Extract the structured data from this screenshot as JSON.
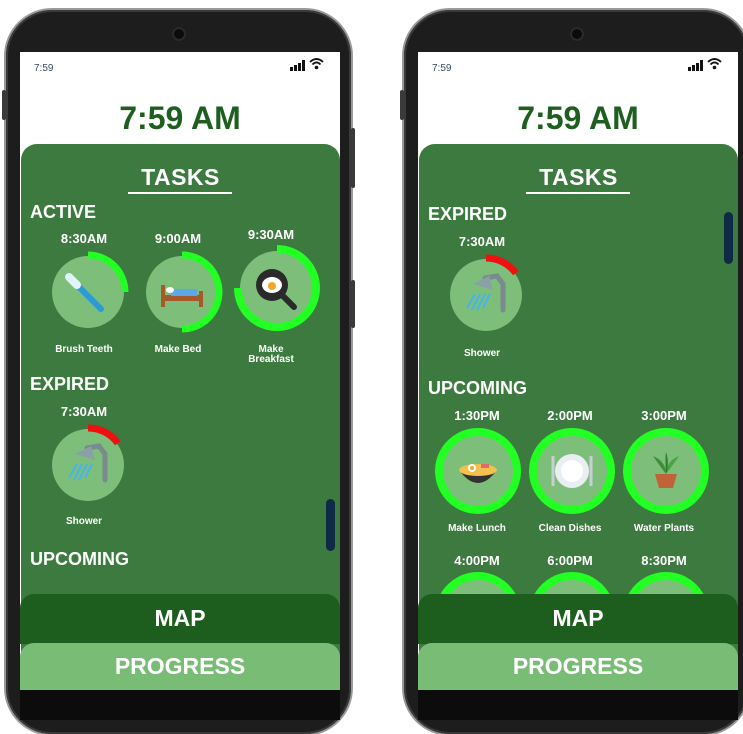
{
  "left_phone": {
    "status_time": "7:59",
    "clock": "7:59 AM",
    "tasks_title": "TASKS",
    "active_heading": "ACTIVE",
    "active_tasks": [
      {
        "time": "8:30AM",
        "label": "Brush Teeth",
        "icon": "toothbrush-icon",
        "ring_progress": 0.25,
        "ring_color": "#22ff22"
      },
      {
        "time": "9:00AM",
        "label": "Make Bed",
        "icon": "bed-icon",
        "ring_progress": 0.5,
        "ring_color": "#22ff22"
      },
      {
        "time": "9:30AM",
        "label": "Make Breakfast",
        "icon": "frying-pan-icon",
        "ring_progress": 0.75,
        "ring_color": "#22ff22"
      }
    ],
    "expired_heading": "EXPIRED",
    "expired_tasks": [
      {
        "time": "7:30AM",
        "label": "Shower",
        "icon": "shower-icon",
        "ring_progress": 0.15,
        "ring_color": "#ee1111"
      }
    ],
    "upcoming_heading": "UPCOMING",
    "map_label": "MAP",
    "progress_label": "PROGRESS"
  },
  "right_phone": {
    "status_time": "7:59",
    "clock": "7:59 AM",
    "tasks_title": "TASKS",
    "expired_heading": "EXPIRED",
    "expired_tasks": [
      {
        "time": "7:30AM",
        "label": "Shower",
        "icon": "shower-icon",
        "ring_progress": 0.15,
        "ring_color": "#ee1111"
      }
    ],
    "upcoming_heading": "UPCOMING",
    "upcoming_tasks": [
      {
        "time": "1:30PM",
        "label": "Make Lunch",
        "icon": "noodle-bowl-icon",
        "ring_progress": 1.0,
        "ring_color": "#22ff22"
      },
      {
        "time": "2:00PM",
        "label": "Clean Dishes",
        "icon": "plate-icon",
        "ring_progress": 1.0,
        "ring_color": "#22ff22"
      },
      {
        "time": "3:00PM",
        "label": "Water Plants",
        "icon": "potted-plant-icon",
        "ring_progress": 1.0,
        "ring_color": "#22ff22"
      }
    ],
    "upcoming_tasks_row2": [
      {
        "time": "4:00PM",
        "ring_progress": 1.0,
        "ring_color": "#22ff22"
      },
      {
        "time": "6:00PM",
        "ring_progress": 1.0,
        "ring_color": "#22ff22"
      },
      {
        "time": "8:30PM",
        "ring_progress": 1.0,
        "ring_color": "#22ff22"
      }
    ],
    "map_label": "MAP",
    "progress_label": "PROGRESS"
  },
  "colors": {
    "panel_green": "#3d7a3f",
    "map_green": "#1d5e1f",
    "progress_green": "#79bc76",
    "clock_green": "#1e5f20",
    "ring_active": "#22ff22",
    "ring_expired": "#ee1111",
    "task_circle": "#7dbe7a"
  }
}
